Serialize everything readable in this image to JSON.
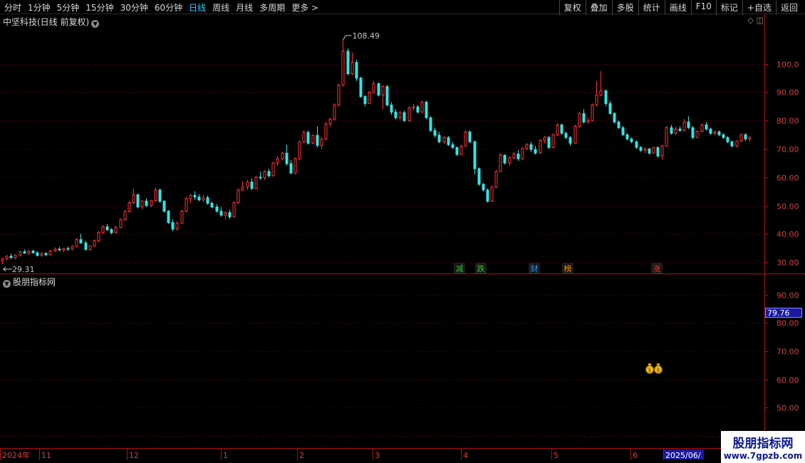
{
  "toolbar": {
    "periods": [
      "分时",
      "1分钟",
      "5分钟",
      "15分钟",
      "30分钟",
      "60分钟",
      "日线",
      "周线",
      "月线",
      "多周期",
      "更多"
    ],
    "active_period": "日线",
    "more_arrow": ">",
    "actions": [
      "复权",
      "叠加",
      "多股",
      "统计",
      "画线",
      "F10",
      "标记",
      "+自选",
      "返回"
    ]
  },
  "chart": {
    "title": "中坚科技(日线 前复权)",
    "high_label": "108.49",
    "low_label": "29.31",
    "price_ticks": [
      "100.0",
      "90.00",
      "80.00",
      "70.00",
      "60.00",
      "50.00",
      "40.00",
      "30.00"
    ],
    "events": [
      {
        "text": "减",
        "color": "#33cc33"
      },
      {
        "text": "跌",
        "color": "#33cc33"
      },
      {
        "text": "财",
        "color": "#3399ff"
      },
      {
        "text": "榜",
        "color": "#ff9900"
      },
      {
        "text": "涨",
        "color": "#ff3333"
      }
    ],
    "colors": {
      "up": "#ff3333",
      "down": "#33e5e5",
      "grid": "#5a0000",
      "axis": "#b01010",
      "tick_text": "#d04040"
    }
  },
  "indicator": {
    "title": "股朋指标网",
    "ticks": [
      "90.00",
      "80.00",
      "70.00",
      "60.00",
      "50.00",
      "40.00"
    ],
    "current_value": "79.76",
    "marker_icon": "money-bag-icon"
  },
  "date_axis": {
    "labels": [
      "2024年",
      "11",
      "12",
      "1",
      "2",
      "3",
      "4",
      "5",
      "6",
      "2025/06/"
    ]
  },
  "watermark": {
    "line1": "股朋指标网",
    "line2": "www.7gpzb.com"
  },
  "chart_data": {
    "type": "candlestick",
    "title": "中坚科技(日线 前复权)",
    "ylim": [
      26,
      113
    ],
    "high": 108.49,
    "low": 29.31,
    "ohlc": [
      [
        30.5,
        31.5,
        29.31,
        31.2
      ],
      [
        31.2,
        32.5,
        30.8,
        32.1
      ],
      [
        32.1,
        33.0,
        31.2,
        31.6
      ],
      [
        31.6,
        32.8,
        31.0,
        32.5
      ],
      [
        32.5,
        34.0,
        32.1,
        33.7
      ],
      [
        33.7,
        34.5,
        33.0,
        33.2
      ],
      [
        33.2,
        34.2,
        32.6,
        33.9
      ],
      [
        33.9,
        34.5,
        33.1,
        33.3
      ],
      [
        33.3,
        33.8,
        32.0,
        32.4
      ],
      [
        32.4,
        33.5,
        31.9,
        33.1
      ],
      [
        33.1,
        33.6,
        32.2,
        32.6
      ],
      [
        32.6,
        34.3,
        32.4,
        34.0
      ],
      [
        34.0,
        35.2,
        33.6,
        34.6
      ],
      [
        34.6,
        35.4,
        33.9,
        34.3
      ],
      [
        34.3,
        35.0,
        33.5,
        34.8
      ],
      [
        34.8,
        35.5,
        34.0,
        34.6
      ],
      [
        34.6,
        36.0,
        34.2,
        35.5
      ],
      [
        35.5,
        38.5,
        35.2,
        38.0
      ],
      [
        38.0,
        40.0,
        36.5,
        36.8
      ],
      [
        36.8,
        37.5,
        34.0,
        34.5
      ],
      [
        34.5,
        36.0,
        34.1,
        35.8
      ],
      [
        35.8,
        38.0,
        35.5,
        37.6
      ],
      [
        37.6,
        41.0,
        37.0,
        40.5
      ],
      [
        40.5,
        43.0,
        40.0,
        42.5
      ],
      [
        42.5,
        43.5,
        41.0,
        41.5
      ],
      [
        41.5,
        42.0,
        39.8,
        40.4
      ],
      [
        40.4,
        42.8,
        40.1,
        42.2
      ],
      [
        42.2,
        45.5,
        42.0,
        45.0
      ],
      [
        45.0,
        48.5,
        44.6,
        47.9
      ],
      [
        47.9,
        51.5,
        47.5,
        51.0
      ],
      [
        51.0,
        56.0,
        50.5,
        53.8
      ],
      [
        53.8,
        54.2,
        49.0,
        49.5
      ],
      [
        49.5,
        52.0,
        48.8,
        51.6
      ],
      [
        51.6,
        52.5,
        49.5,
        50.0
      ],
      [
        50.0,
        52.0,
        49.3,
        51.8
      ],
      [
        51.8,
        56.5,
        51.5,
        55.5
      ],
      [
        55.5,
        56.0,
        51.0,
        51.5
      ],
      [
        51.5,
        51.9,
        47.5,
        48.0
      ],
      [
        48.0,
        48.4,
        43.5,
        44.0
      ],
      [
        44.0,
        45.0,
        41.0,
        41.7
      ],
      [
        41.7,
        44.5,
        41.2,
        43.8
      ],
      [
        43.8,
        48.5,
        43.5,
        48.0
      ],
      [
        48.0,
        53.0,
        47.6,
        52.5
      ],
      [
        52.5,
        54.0,
        51.0,
        53.6
      ],
      [
        53.6,
        55.0,
        52.0,
        53.0
      ],
      [
        53.0,
        54.0,
        51.5,
        52.0
      ],
      [
        52.0,
        53.8,
        51.2,
        52.8
      ],
      [
        52.8,
        53.5,
        50.3,
        50.8
      ],
      [
        50.8,
        51.5,
        49.0,
        49.5
      ],
      [
        49.5,
        50.5,
        47.5,
        48.0
      ],
      [
        48.0,
        49.5,
        46.0,
        46.6
      ],
      [
        46.6,
        48.0,
        45.2,
        47.5
      ],
      [
        47.5,
        48.5,
        45.3,
        46.0
      ],
      [
        46.0,
        51.5,
        45.8,
        51.0
      ],
      [
        51.0,
        56.0,
        50.6,
        55.5
      ],
      [
        55.5,
        58.5,
        55.0,
        56.5
      ],
      [
        56.5,
        59.0,
        55.5,
        58.3
      ],
      [
        58.3,
        59.5,
        55.5,
        56.0
      ],
      [
        56.0,
        60.5,
        55.8,
        60.0
      ],
      [
        60.0,
        62.0,
        59.0,
        59.8
      ],
      [
        59.8,
        62.5,
        59.0,
        62.0
      ],
      [
        62.0,
        63.0,
        60.0,
        60.5
      ],
      [
        60.5,
        65.5,
        60.2,
        65.0
      ],
      [
        65.0,
        67.5,
        64.0,
        66.5
      ],
      [
        66.5,
        69.0,
        66.0,
        68.5
      ],
      [
        68.5,
        71.5,
        64.0,
        64.8
      ],
      [
        64.8,
        66.0,
        61.0,
        61.5
      ],
      [
        61.5,
        67.0,
        61.0,
        66.5
      ],
      [
        66.5,
        73.0,
        66.0,
        72.5
      ],
      [
        72.5,
        76.5,
        72.0,
        75.8
      ],
      [
        75.8,
        76.5,
        71.5,
        72.0
      ],
      [
        72.0,
        75.0,
        71.5,
        74.8
      ],
      [
        74.8,
        78.0,
        70.5,
        71.2
      ],
      [
        71.2,
        74.0,
        70.0,
        73.5
      ],
      [
        73.5,
        79.5,
        73.0,
        78.8
      ],
      [
        78.8,
        81.0,
        78.0,
        80.5
      ],
      [
        80.5,
        86.0,
        80.0,
        85.5
      ],
      [
        85.5,
        93.0,
        85.0,
        92.5
      ],
      [
        92.5,
        108.49,
        92.0,
        104.5
      ],
      [
        104.5,
        105.5,
        96.0,
        96.5
      ],
      [
        96.5,
        104.0,
        96.0,
        100.5
      ],
      [
        100.5,
        101.5,
        94.0,
        95.0
      ],
      [
        95.0,
        95.5,
        88.0,
        88.5
      ],
      [
        88.5,
        89.0,
        85.0,
        86.0
      ],
      [
        86.0,
        90.5,
        85.8,
        90.0
      ],
      [
        90.0,
        94.0,
        89.5,
        93.0
      ],
      [
        93.0,
        93.5,
        88.5,
        89.0
      ],
      [
        89.0,
        92.5,
        84.0,
        92.0
      ],
      [
        92.0,
        92.5,
        85.0,
        85.5
      ],
      [
        85.5,
        86.5,
        82.0,
        83.0
      ],
      [
        83.0,
        84.0,
        80.5,
        81.0
      ],
      [
        81.0,
        83.5,
        80.0,
        82.8
      ],
      [
        82.8,
        83.5,
        79.5,
        80.0
      ],
      [
        80.0,
        85.0,
        79.5,
        84.5
      ],
      [
        84.5,
        86.0,
        83.5,
        84.8
      ],
      [
        84.8,
        85.5,
        82.5,
        83.0
      ],
      [
        83.0,
        87.0,
        82.8,
        86.5
      ],
      [
        86.5,
        87.0,
        80.5,
        81.0
      ],
      [
        81.0,
        81.5,
        76.0,
        76.5
      ],
      [
        76.5,
        77.5,
        74.0,
        74.8
      ],
      [
        74.8,
        76.0,
        72.0,
        72.5
      ],
      [
        72.5,
        74.5,
        71.8,
        74.0
      ],
      [
        74.0,
        74.5,
        71.0,
        71.5
      ],
      [
        71.5,
        72.5,
        70.0,
        70.5
      ],
      [
        70.5,
        70.8,
        67.5,
        68.0
      ],
      [
        68.0,
        71.5,
        67.8,
        71.0
      ],
      [
        71.0,
        76.5,
        70.8,
        76.0
      ],
      [
        76.0,
        76.5,
        72.0,
        72.5
      ],
      [
        72.5,
        73.0,
        61.0,
        63.0
      ],
      [
        63.0,
        63.5,
        57.0,
        57.5
      ],
      [
        57.5,
        58.0,
        55.0,
        55.5
      ],
      [
        55.5,
        56.0,
        51.0,
        51.5
      ],
      [
        51.5,
        57.0,
        51.3,
        56.5
      ],
      [
        56.5,
        62.5,
        56.2,
        62.0
      ],
      [
        62.0,
        68.5,
        61.8,
        67.8
      ],
      [
        67.8,
        68.0,
        64.5,
        65.0
      ],
      [
        65.0,
        67.5,
        64.0,
        66.8
      ],
      [
        66.8,
        69.0,
        66.2,
        68.2
      ],
      [
        68.2,
        69.5,
        65.8,
        66.5
      ],
      [
        66.5,
        70.5,
        66.0,
        70.2
      ],
      [
        70.2,
        72.0,
        69.5,
        71.5
      ],
      [
        71.5,
        72.5,
        69.0,
        69.8
      ],
      [
        69.8,
        71.0,
        68.0,
        68.5
      ],
      [
        68.5,
        73.5,
        68.2,
        73.0
      ],
      [
        73.0,
        74.5,
        72.0,
        74.0
      ],
      [
        74.0,
        74.5,
        70.0,
        70.5
      ],
      [
        70.5,
        75.5,
        70.2,
        75.0
      ],
      [
        75.0,
        79.0,
        74.5,
        78.5
      ],
      [
        78.5,
        79.0,
        75.0,
        75.5
      ],
      [
        75.5,
        76.0,
        73.5,
        74.0
      ],
      [
        74.0,
        74.5,
        71.0,
        72.0
      ],
      [
        72.0,
        78.5,
        71.8,
        78.0
      ],
      [
        78.0,
        83.0,
        77.5,
        82.5
      ],
      [
        82.5,
        84.0,
        79.0,
        79.5
      ],
      [
        79.5,
        81.0,
        79.0,
        80.0
      ],
      [
        80.0,
        86.0,
        79.8,
        85.5
      ],
      [
        85.5,
        94.0,
        85.0,
        89.0
      ],
      [
        89.0,
        97.5,
        88.5,
        90.5
      ],
      [
        90.5,
        91.0,
        85.0,
        86.0
      ],
      [
        86.0,
        87.0,
        82.0,
        82.5
      ],
      [
        82.5,
        83.0,
        79.0,
        79.5
      ],
      [
        79.5,
        80.0,
        77.0,
        77.5
      ],
      [
        77.5,
        78.0,
        74.5,
        75.0
      ],
      [
        75.0,
        75.5,
        73.0,
        73.5
      ],
      [
        73.5,
        74.0,
        72.0,
        72.5
      ],
      [
        72.5,
        73.0,
        70.0,
        70.5
      ],
      [
        70.5,
        71.0,
        68.8,
        69.5
      ],
      [
        69.5,
        70.5,
        68.5,
        70.0
      ],
      [
        70.0,
        70.2,
        68.0,
        68.5
      ],
      [
        68.5,
        70.8,
        68.2,
        70.5
      ],
      [
        70.5,
        70.8,
        67.0,
        67.5
      ],
      [
        67.5,
        71.5,
        66.2,
        71.0
      ],
      [
        71.0,
        78.0,
        70.8,
        77.5
      ],
      [
        77.5,
        78.5,
        75.0,
        75.5
      ],
      [
        75.5,
        78.0,
        75.0,
        77.0
      ],
      [
        77.0,
        78.0,
        76.0,
        76.5
      ],
      [
        76.5,
        80.5,
        76.2,
        79.5
      ],
      [
        79.5,
        81.5,
        77.0,
        77.5
      ],
      [
        77.5,
        78.0,
        73.5,
        74.0
      ],
      [
        74.0,
        76.5,
        73.8,
        76.2
      ],
      [
        76.2,
        79.0,
        76.0,
        78.5
      ],
      [
        78.5,
        79.5,
        76.5,
        77.0
      ],
      [
        77.0,
        77.5,
        75.0,
        75.5
      ],
      [
        75.5,
        76.5,
        74.8,
        76.0
      ],
      [
        76.0,
        76.5,
        74.5,
        75.0
      ],
      [
        75.0,
        75.5,
        73.5,
        74.0
      ],
      [
        74.0,
        74.5,
        72.0,
        72.5
      ],
      [
        72.5,
        73.0,
        70.5,
        71.0
      ],
      [
        71.0,
        73.0,
        70.5,
        72.8
      ],
      [
        72.8,
        75.5,
        72.5,
        75.0
      ],
      [
        75.0,
        75.5,
        72.8,
        73.5
      ],
      [
        73.5,
        74.5,
        72.5,
        74.0
      ]
    ],
    "indicator_ylim": [
      36,
      97
    ],
    "indicator_value": 79.76,
    "indicator_marker_value": 63.5
  }
}
